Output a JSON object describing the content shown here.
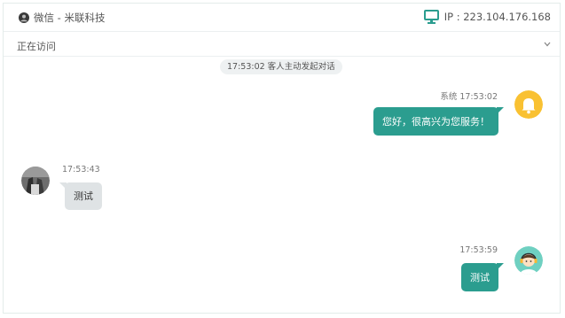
{
  "header": {
    "channel_title": "微信 - 米联科技",
    "ip_text": "IP : 223.104.176.168"
  },
  "statusbar": {
    "text": "正在访问"
  },
  "messages": {
    "system_notice": "17:53:02 客人主动发起对话",
    "msg1": {
      "meta": "系统 17:53:02",
      "text": "您好，很高兴为您服务！"
    },
    "msg2": {
      "meta": "17:53:43",
      "text": "测试"
    },
    "msg3": {
      "meta": "17:53:59",
      "text": "测试"
    }
  },
  "colors": {
    "accent": "#2b9d8f",
    "bell": "#f9c132",
    "guest_bubble": "#dfe3e5"
  },
  "icons": {
    "header_left": "wechat-avatar-icon",
    "header_right": "monitor-icon",
    "statusbar_right": "chevron-down-icon",
    "msg1_avatar": "bell-icon",
    "msg2_avatar": "guest-avatar",
    "msg3_avatar": "agent-avatar"
  }
}
